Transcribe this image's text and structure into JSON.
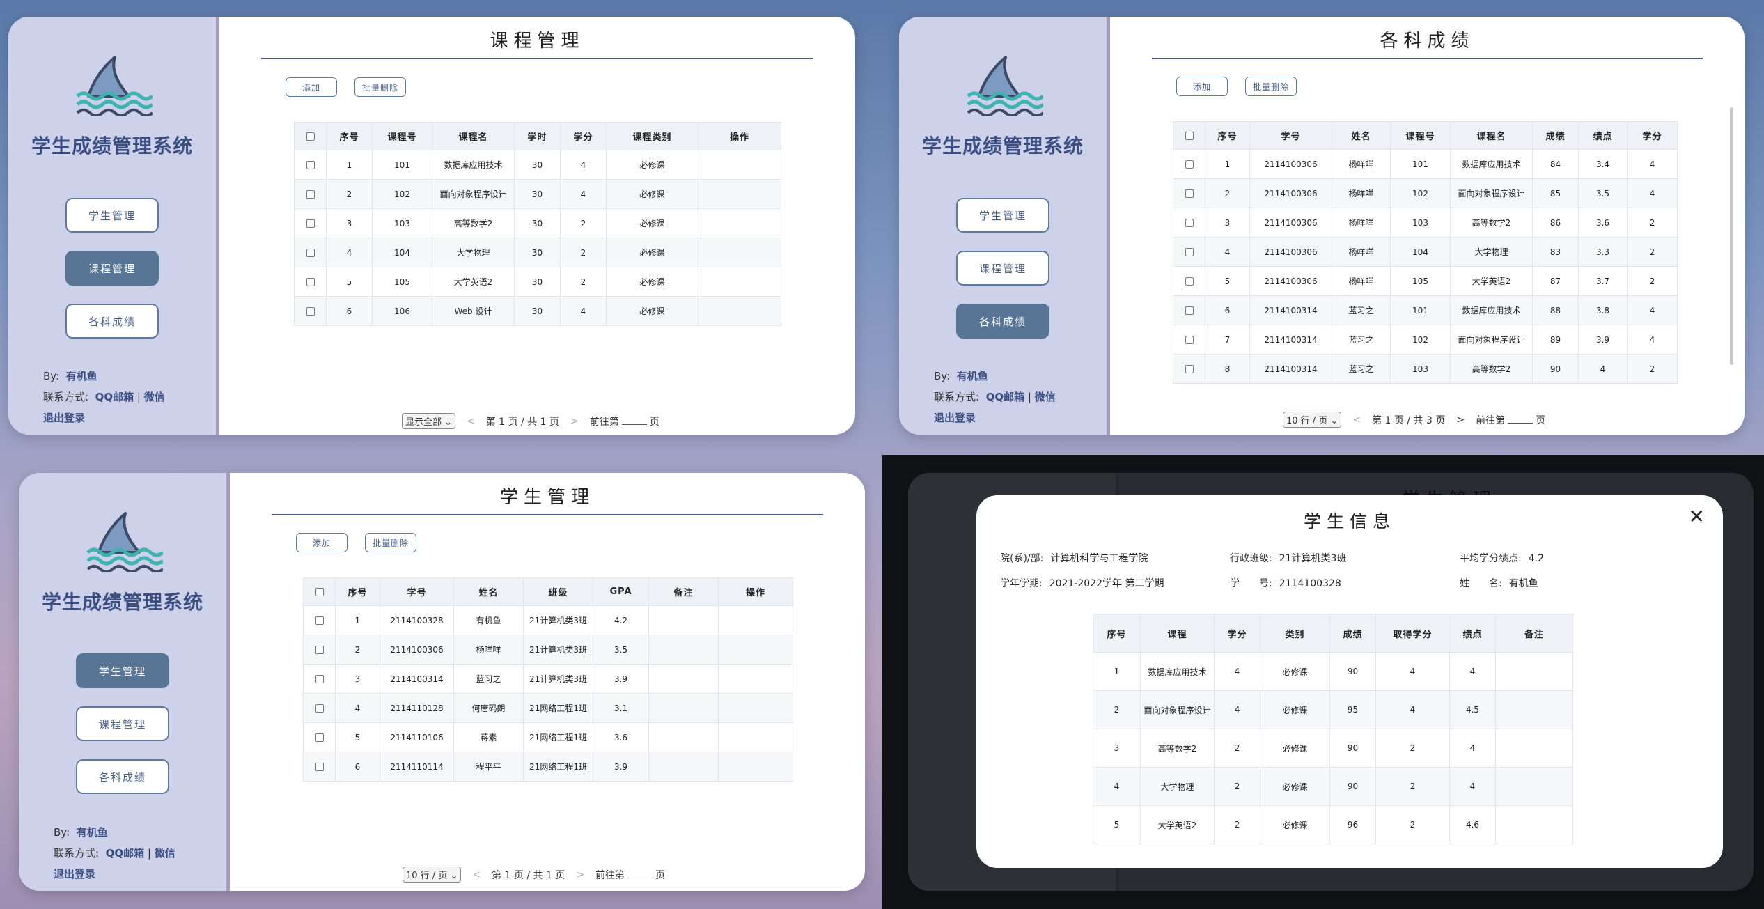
{
  "app": {
    "title": "学生成绩管理系统",
    "nav_students": "学生管理",
    "nav_courses": "课程管理",
    "nav_scores": "各科成绩",
    "by_label": "By:",
    "author": "有机鱼",
    "contact_label": "联系方式:",
    "contact_qq": "QQ邮箱",
    "contact_sep": "|",
    "contact_wx": "微信",
    "logout": "退出登录"
  },
  "common": {
    "add": "添加",
    "batch_delete": "批量删除",
    "op": "操作",
    "goto_prefix": "前往第",
    "goto_suffix": "页",
    "prev": "<",
    "next": ">"
  },
  "courses": {
    "title": "课程管理",
    "headers": [
      "序号",
      "课程号",
      "课程名",
      "学时",
      "学分",
      "课程类别",
      "操作"
    ],
    "rows": [
      [
        "1",
        "101",
        "数据库应用技术",
        "30",
        "4",
        "必修课"
      ],
      [
        "2",
        "102",
        "面向对象程序设计",
        "30",
        "4",
        "必修课"
      ],
      [
        "3",
        "103",
        "高等数学2",
        "30",
        "2",
        "必修课"
      ],
      [
        "4",
        "104",
        "大学物理",
        "30",
        "2",
        "必修课"
      ],
      [
        "5",
        "105",
        "大学英语2",
        "30",
        "2",
        "必修课"
      ],
      [
        "6",
        "106",
        "Web 设计",
        "30",
        "4",
        "必修课"
      ]
    ],
    "page_size": "显示全部",
    "page_info": "第 1 页 / 共 1 页"
  },
  "scores": {
    "title": "各科成绩",
    "headers": [
      "序号",
      "学号",
      "姓名",
      "课程号",
      "课程名",
      "成绩",
      "绩点",
      "学分"
    ],
    "rows": [
      [
        "1",
        "2114100306",
        "杨咩咩",
        "101",
        "数据库应用技术",
        "84",
        "3.4",
        "4"
      ],
      [
        "2",
        "2114100306",
        "杨咩咩",
        "102",
        "面向对象程序设计",
        "85",
        "3.5",
        "4"
      ],
      [
        "3",
        "2114100306",
        "杨咩咩",
        "103",
        "高等数学2",
        "86",
        "3.6",
        "2"
      ],
      [
        "4",
        "2114100306",
        "杨咩咩",
        "104",
        "大学物理",
        "83",
        "3.3",
        "2"
      ],
      [
        "5",
        "2114100306",
        "杨咩咩",
        "105",
        "大学英语2",
        "87",
        "3.7",
        "2"
      ],
      [
        "6",
        "2114100314",
        "蓝习之",
        "101",
        "数据库应用技术",
        "88",
        "3.8",
        "4"
      ],
      [
        "7",
        "2114100314",
        "蓝习之",
        "102",
        "面向对象程序设计",
        "89",
        "3.9",
        "4"
      ],
      [
        "8",
        "2114100314",
        "蓝习之",
        "103",
        "高等数学2",
        "90",
        "4",
        "2"
      ]
    ],
    "page_size": "10 行 / 页",
    "page_info": "第 1 页 / 共 3 页"
  },
  "students": {
    "title": "学生管理",
    "headers": [
      "序号",
      "学号",
      "姓名",
      "班级",
      "GPA",
      "备注",
      "操作"
    ],
    "rows": [
      [
        "1",
        "2114100328",
        "有机鱼",
        "21计算机类3班",
        "4.2"
      ],
      [
        "2",
        "2114100306",
        "杨咩咩",
        "21计算机类3班",
        "3.5"
      ],
      [
        "3",
        "2114100314",
        "蓝习之",
        "21计算机类3班",
        "3.9"
      ],
      [
        "4",
        "2114110128",
        "何唐码朗",
        "21网络工程1班",
        "3.1"
      ],
      [
        "5",
        "2114110106",
        "蒋素",
        "21网络工程1班",
        "3.6"
      ],
      [
        "6",
        "2114110114",
        "程平平",
        "21网络工程1班",
        "3.9"
      ]
    ],
    "page_size": "10 行 / 页",
    "page_info": "第 1 页 / 共 1 页"
  },
  "modal": {
    "title": "学生信息",
    "close": "✕",
    "dept_label": "院(系)/部:",
    "dept": "计算机科学与工程学院",
    "class_label": "行政班级:",
    "class": "21计算机类3班",
    "gpa_label": "平均学分绩点:",
    "gpa": "4.2",
    "term_label": "学年学期:",
    "term": "2021-2022学年 第二学期",
    "id_label": "学　　号:",
    "id": "2114100328",
    "name_label": "姓　　名:",
    "name": "有机鱼",
    "headers": [
      "序号",
      "课程",
      "学分",
      "类别",
      "成绩",
      "取得学分",
      "绩点",
      "备注"
    ],
    "rows": [
      [
        "1",
        "数据库应用技术",
        "4",
        "必修课",
        "90",
        "4",
        "4"
      ],
      [
        "2",
        "面向对象程序设计",
        "4",
        "必修课",
        "95",
        "4",
        "4.5"
      ],
      [
        "3",
        "高等数学2",
        "2",
        "必修课",
        "90",
        "2",
        "4"
      ],
      [
        "4",
        "大学物理",
        "2",
        "必修课",
        "90",
        "2",
        "4"
      ],
      [
        "5",
        "大学英语2",
        "2",
        "必修课",
        "96",
        "2",
        "4.6"
      ]
    ]
  }
}
